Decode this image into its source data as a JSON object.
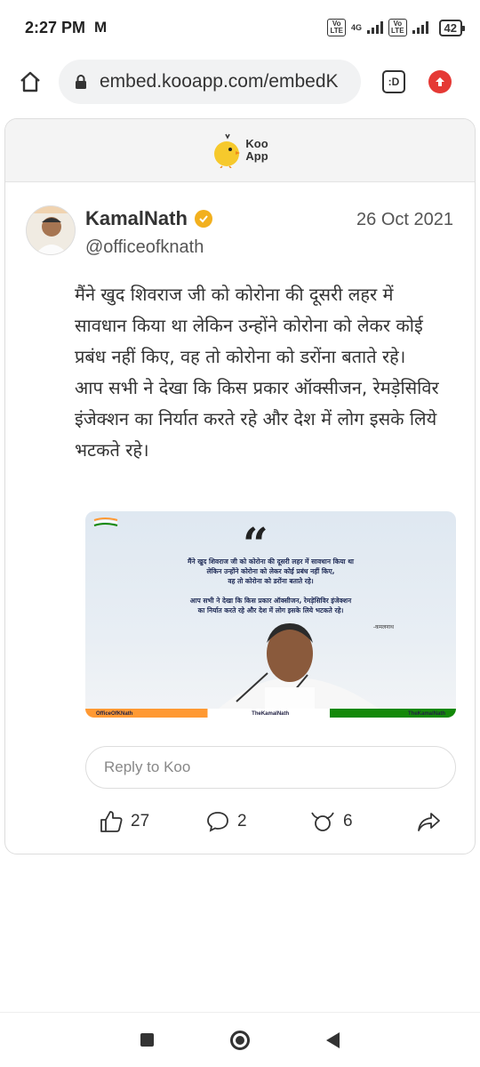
{
  "status_bar": {
    "time": "2:27 PM",
    "carrier_icon": "M",
    "network_type": "4G",
    "volte_label": "Vo LTE",
    "battery": "42"
  },
  "browser": {
    "url": "embed.kooapp.com/embedK",
    "tab_label": ":D",
    "home_icon": "home-icon",
    "lock_icon": "lock-icon"
  },
  "koo": {
    "logo_line1": "Koo",
    "logo_line2": "App"
  },
  "post": {
    "author_name": "KamalNath",
    "author_handle": "@officeofknath",
    "date": "26 Oct 2021",
    "text": "मैंने खुद शिवराज जी को कोरोना की दूसरी लहर में सावधान किया था लेकिन उन्होंने कोरोना को लेकर कोई प्रबंध नहीं किए, वह तो कोरोना को डरोंना बताते रहे। आप सभी ने देखा कि किस प्रकार ऑक्सीजन, रेमड़ेसिविर इंजेक्शन का निर्यात करते रहे और देश में लोग इसके लिये भटकते रहे।",
    "image": {
      "line1": "मैंने खुद शिवराज जी को कोरोना की दूसरी लहर में सावधान किया था",
      "line2": "लेकिन उन्होंने कोरोना को लेकर कोई प्रबंध नहीं किए,",
      "line3": "वह तो कोरोना को डरोंना बताते रहे।",
      "line4": "आप सभी ने देखा कि किस प्रकार ऑक्सीजन, रेमड़ेसिविर इंजेक्शन",
      "line5": "का निर्यात करते रहे और देश में लोग इसके लिये भटकते रहे।",
      "signature": "-कमलनाथ",
      "footer_twitter": "OfficeOfKNath",
      "footer_facebook": "TheKamalNath",
      "footer_instagram": "TheKamalNath"
    },
    "reply_placeholder": "Reply to Koo",
    "likes": "27",
    "comments": "2",
    "rekoos": "6"
  },
  "colors": {
    "accent_red": "#e53935",
    "verified_gold": "#f2b01e",
    "koo_yellow": "#f6c92c"
  }
}
